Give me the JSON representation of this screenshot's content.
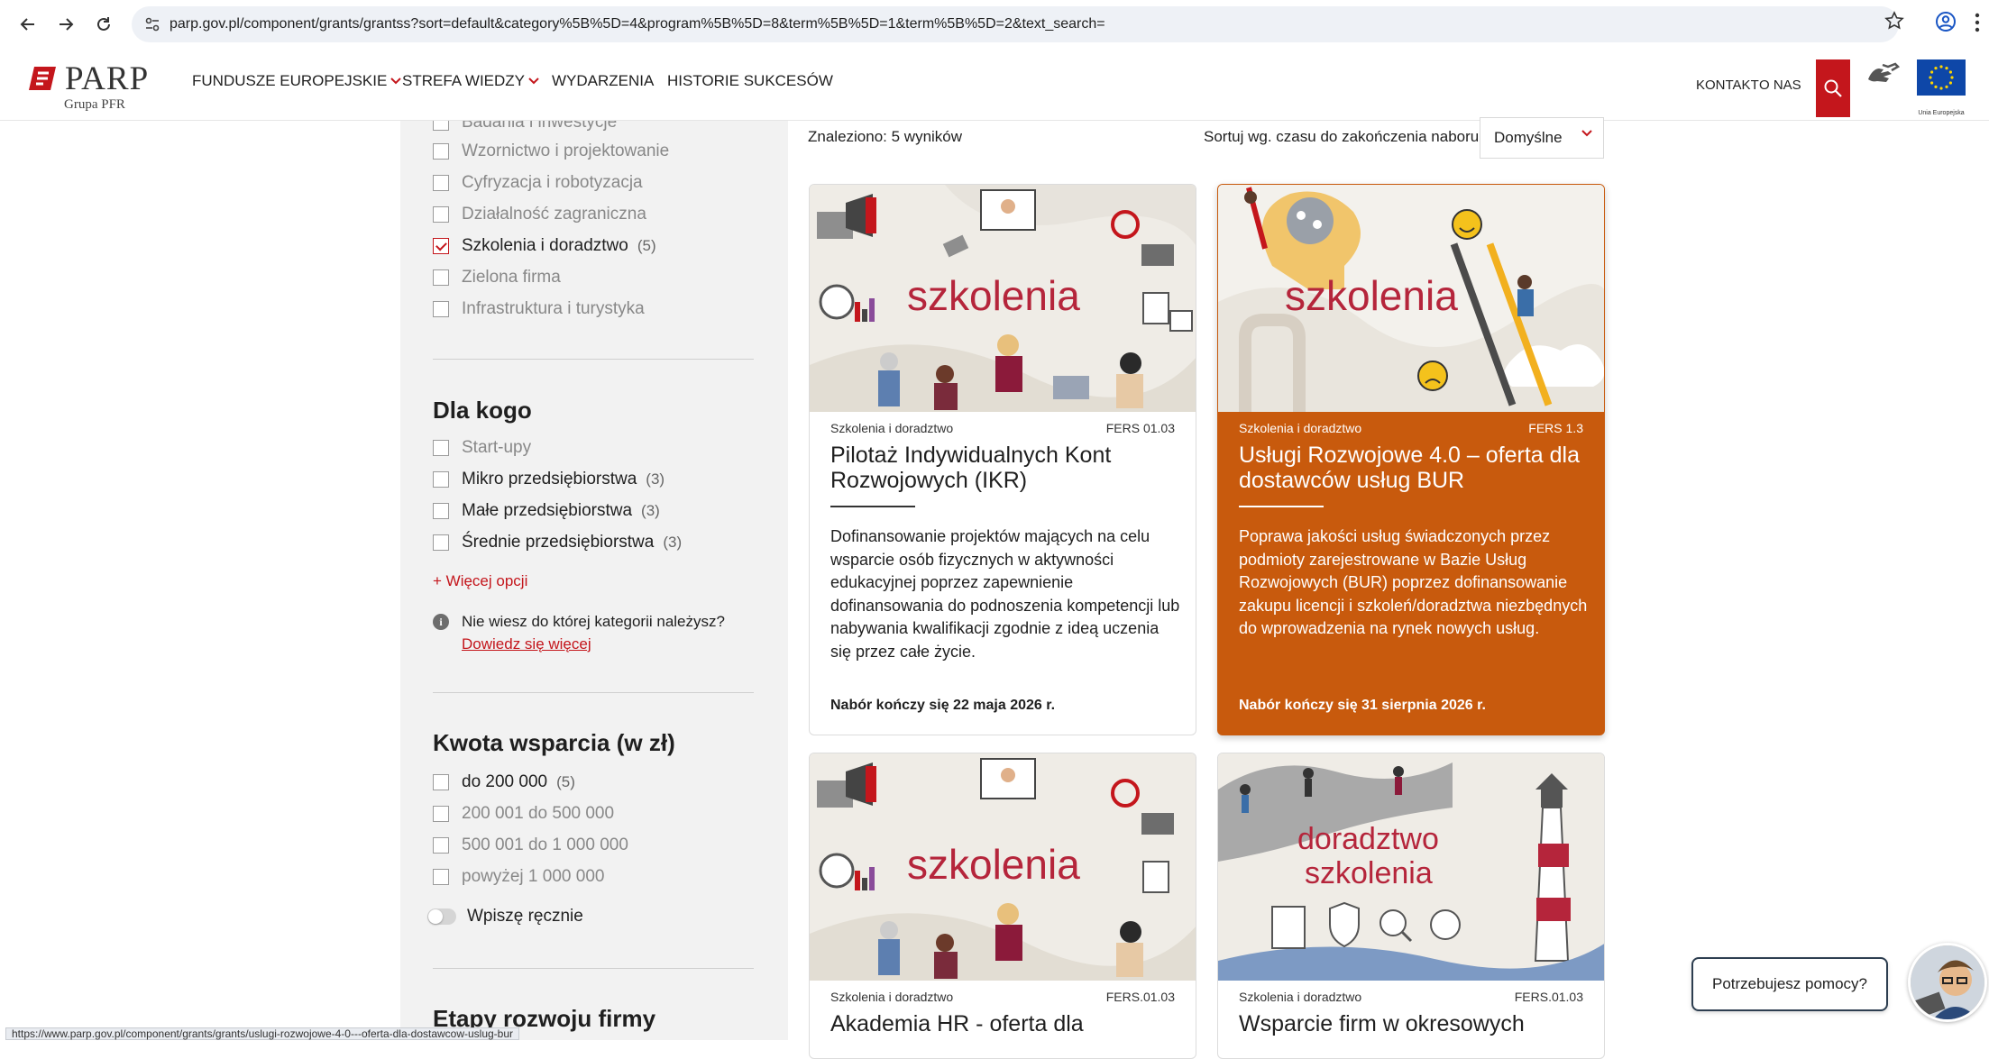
{
  "browser": {
    "url": "parp.gov.pl/component/grants/grantss?sort=default&category%5B%5D=4&program%5B%5D=8&term%5B%5D=1&term%5B%5D=2&text_search=",
    "status_url": "https://www.parp.gov.pl/component/grants/grants/uslugi-rozwojowe-4-0---oferta-dla-dostawcow-uslug-bur"
  },
  "header": {
    "logo_word": "PARP",
    "logo_sub": "Grupa PFR",
    "nav": [
      {
        "label": "FUNDUSZE EUROPEJSKIE"
      },
      {
        "label": "STREFA WIEDZY"
      },
      {
        "label": "WYDARZENIA"
      },
      {
        "label": "HISTORIE SUKCESÓW"
      }
    ],
    "kontakt": "KONTAKT",
    "o_nas": "O NAS",
    "eu_caption": "Unia Europejska"
  },
  "sidebar": {
    "partial_item": "Badania i inwestycje",
    "categories": [
      {
        "label": "Wzornictwo i projektowanie"
      },
      {
        "label": "Cyfryzacja i robotyzacja"
      },
      {
        "label": "Działalność zagraniczna"
      },
      {
        "label": "Szkolenia i doradztwo",
        "count": "(5)",
        "checked": true
      },
      {
        "label": "Zielona firma"
      },
      {
        "label": "Infrastruktura i turystyka"
      }
    ],
    "for_whom_heading": "Dla kogo",
    "for_whom": [
      {
        "label": "Start-upy"
      },
      {
        "label": "Mikro przedsiębiorstwa",
        "count": "(3)"
      },
      {
        "label": "Małe przedsiębiorstwa",
        "count": "(3)"
      },
      {
        "label": "Średnie przedsiębiorstwa",
        "count": "(3)"
      }
    ],
    "more_options": "+ Więcej opcji",
    "info_icon": "i",
    "info_question": "Nie wiesz do której kategorii należysz?",
    "info_link": "Dowiedz się więcej",
    "amount_heading": "Kwota wsparcia (w zł)",
    "amounts": [
      {
        "label": "do 200 000",
        "count": "(5)"
      },
      {
        "label": "200 001 do 500 000"
      },
      {
        "label": "500 001 do 1 000 000"
      },
      {
        "label": "powyżej 1 000 000"
      }
    ],
    "manual_toggle": "Wpiszę ręcznie",
    "stages_heading": "Etapy rozwoju firmy"
  },
  "results": {
    "count_text": "Znaleziono: 5 wyników",
    "sort_label": "Sortuj wg. czasu do zakończenia naboru",
    "sort_value": "Domyślne"
  },
  "cards": [
    {
      "image_word": "szkolenia",
      "category": "Szkolenia i doradztwo",
      "code": "FERS 01.03",
      "title": "Pilotaż Indywidualnych Kont Rozwojowych (IKR)",
      "description": "Dofinansowanie projektów mających na celu wsparcie osób fizycznych w aktywności edukacyjnej poprzez zapewnienie dofinansowania do podnoszenia kompetencji lub nabywania kwalifikacji zgodnie z ideą uczenia się przez całe życie.",
      "deadline": "Nabór kończy się 22 maja 2026 r."
    },
    {
      "image_word": "szkolenia",
      "category": "Szkolenia i doradztwo",
      "code": "FERS 1.3",
      "title": "Usługi Rozwojowe 4.0 – oferta dla dostawców usług BUR",
      "description": "Poprawa jakości usług świadczonych przez podmioty zarejestrowane w Bazie Usług Rozwojowych (BUR) poprzez dofinansowanie zakupu licencji i szkoleń/doradztwa niezbędnych do wprowadzenia na rynek nowych usług.",
      "deadline": "Nabór kończy się 31 sierpnia 2026 r."
    },
    {
      "image_word": "szkolenia",
      "category": "Szkolenia i doradztwo",
      "code": "FERS.01.03",
      "title": "Akademia HR - oferta dla"
    },
    {
      "image_word_1": "doradztwo",
      "image_word_2": "szkolenia",
      "category": "Szkolenia i doradztwo",
      "code": "FERS.01.03",
      "title": "Wsparcie firm w okresowych"
    }
  ],
  "help": {
    "bubble": "Potrzebujesz pomocy?"
  },
  "colors": {
    "brand_red": "#c4161c",
    "featured_card": "#c85a0d",
    "sidebar_bg": "#f2f2f2"
  }
}
